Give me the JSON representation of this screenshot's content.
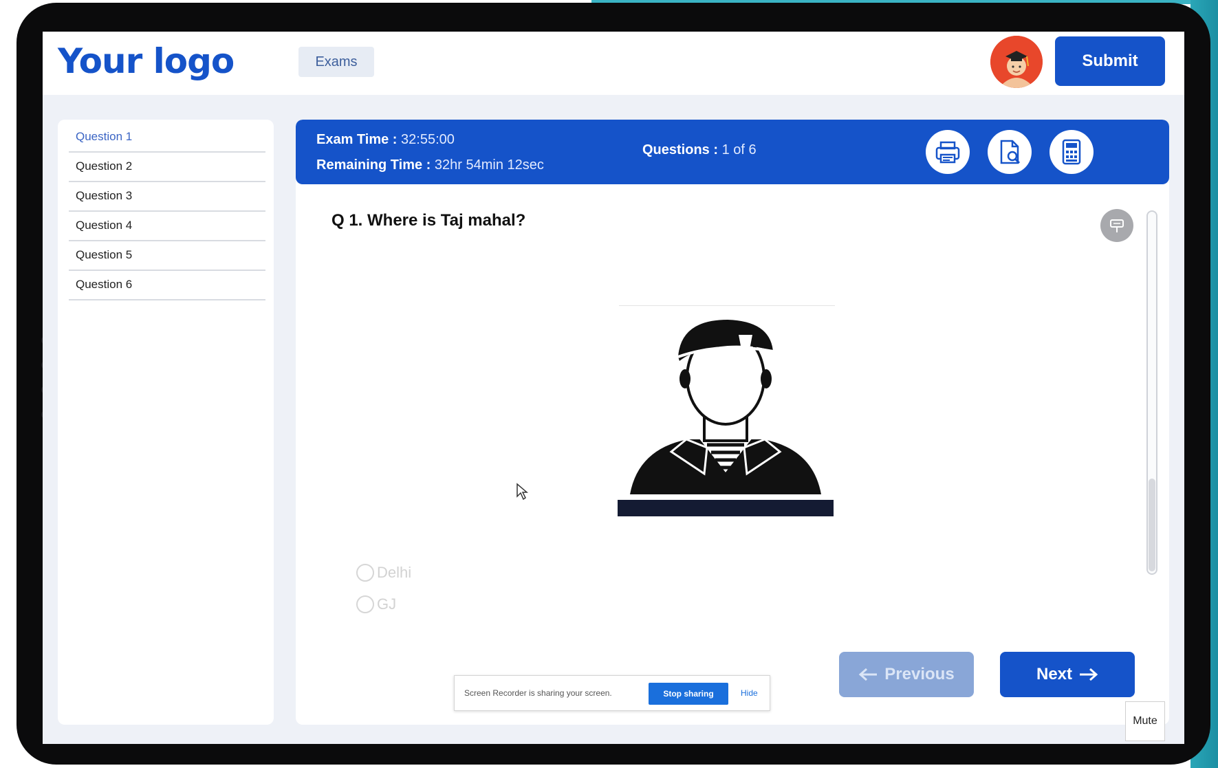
{
  "header": {
    "logo_text": "Your logo",
    "nav_exams": "Exams",
    "submit_label": "Submit"
  },
  "sidebar": {
    "items": [
      {
        "label": "Question 1",
        "active": true
      },
      {
        "label": "Question 2"
      },
      {
        "label": "Question 3"
      },
      {
        "label": "Question 4"
      },
      {
        "label": "Question 5"
      },
      {
        "label": "Question 6"
      }
    ]
  },
  "info_bar": {
    "exam_time_label": "Exam Time :",
    "exam_time_value": "32:55:00",
    "remaining_label": "Remaining Time :",
    "remaining_value": "32hr 54min 12sec",
    "questions_label": "Questions :",
    "questions_value": "1 of 6",
    "tools": [
      "printer-icon",
      "document-search-icon",
      "calculator-icon"
    ]
  },
  "question": {
    "text": "Q 1. Where is Taj mahal?",
    "options": [
      "Delhi",
      "GJ"
    ]
  },
  "screen_share": {
    "message": "Screen Recorder is sharing your screen.",
    "stop_label": "Stop sharing",
    "hide_label": "Hide"
  },
  "navigation": {
    "previous_label": "Previous",
    "next_label": "Next"
  },
  "mute_label": "Mute",
  "colors": {
    "primary": "#1553c9",
    "disabled_button": "#89a6d7",
    "avatar_bg": "#e8472b",
    "teal_frame": "#2aa6b7"
  }
}
